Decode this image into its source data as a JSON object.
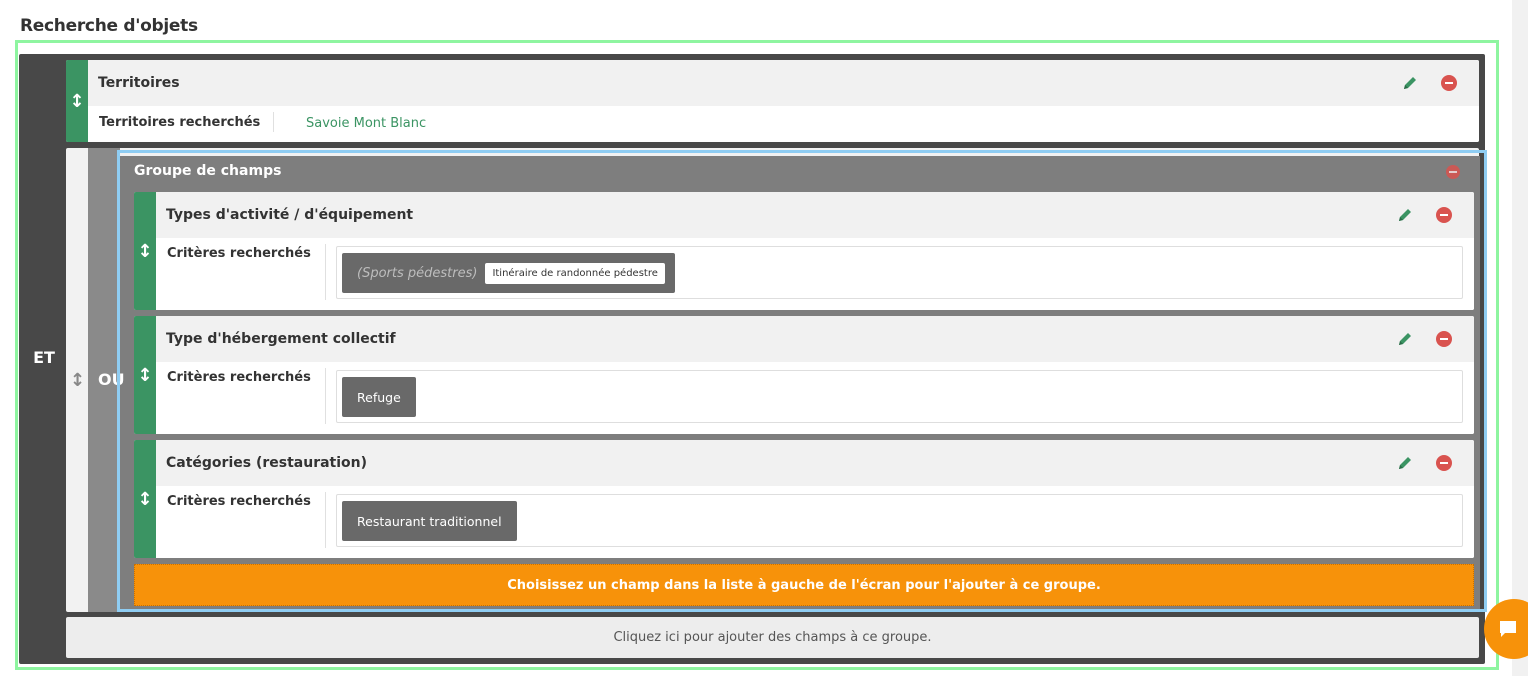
{
  "page": {
    "title": "Recherche d'objets"
  },
  "root_group": {
    "operator": "ET"
  },
  "territoires": {
    "title": "Territoires",
    "label": "Territoires recherchés",
    "value": "Savoie Mont Blanc"
  },
  "or_group": {
    "operator": "OU"
  },
  "field_group": {
    "title": "Groupe de champs",
    "fields": [
      {
        "title": "Types d'activité / d'équipement",
        "label": "Critères recherchés",
        "chip_parent": "(Sports pédestres)",
        "chip_sub": "Itinéraire de randonnée pédestre"
      },
      {
        "title": "Type d'hébergement collectif",
        "label": "Critères recherchés",
        "chip": "Refuge"
      },
      {
        "title": "Catégories (restauration)",
        "label": "Critères recherchés",
        "chip": "Restaurant traditionnel"
      }
    ],
    "drop_hint": "Choisissez un champ dans la liste à gauche de l'écran pour l'ajouter à ce groupe."
  },
  "add_fields": {
    "label": "Cliquez ici pour ajouter des champs à ce groupe."
  },
  "handle_glyph": "↕",
  "icons": {
    "edit": "pencil-icon",
    "remove": "minus-circle-icon",
    "move": "vertical-arrows-icon",
    "chat": "chat-bubble-icon"
  },
  "colors": {
    "accent_green": "#3b9463",
    "remove_red": "#d9534f",
    "hint_orange": "#f7920a",
    "group_grey": "#7e7e7e",
    "root_dark": "#484848"
  }
}
